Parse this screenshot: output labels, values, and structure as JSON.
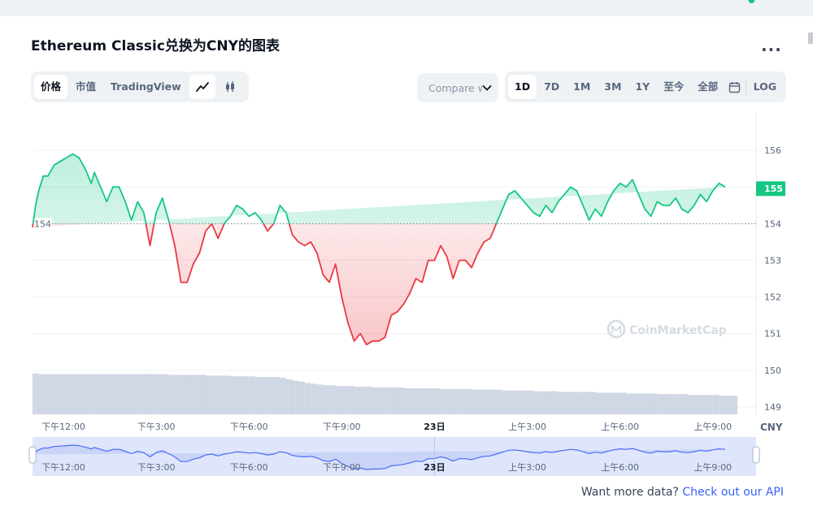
{
  "title": "Ethereum Classic兑换为CNY的图表",
  "more_label": "...",
  "metric_tabs": [
    {
      "label": "价格",
      "active": true
    },
    {
      "label": "市值",
      "active": false
    },
    {
      "label": "TradingView",
      "active": false
    }
  ],
  "chart_type_buttons": [
    {
      "icon": "line-chart-icon",
      "active": true
    },
    {
      "icon": "candlestick-icon",
      "active": false
    }
  ],
  "compare": {
    "label": "Compare with"
  },
  "time_ranges": [
    {
      "label": "1D",
      "active": true
    },
    {
      "label": "7D",
      "active": false
    },
    {
      "label": "1M",
      "active": false
    },
    {
      "label": "3M",
      "active": false
    },
    {
      "label": "1Y",
      "active": false
    },
    {
      "label": "至今",
      "active": false
    },
    {
      "label": "全部",
      "active": false
    },
    {
      "label": "calendar-icon",
      "active": false
    },
    {
      "label": "LOG",
      "active": false
    }
  ],
  "watermark": "CoinMarketCap",
  "currency_label": "CNY",
  "footer": {
    "text": "Want more data?",
    "link": "Check out our API"
  },
  "colors": {
    "up": "#16c784",
    "down": "#ea3943",
    "accent": "#3861fb",
    "volume": "#cfd6e4"
  },
  "chart_data": {
    "type": "line",
    "baseline": 154,
    "baseline_label": "154",
    "current_price": 155,
    "current_label": "155",
    "ylim": [
      148.8,
      157
    ],
    "y_ticks": [
      156,
      155,
      154,
      153,
      152,
      151,
      150,
      149
    ],
    "x_ticks": [
      "下午12:00",
      "下午3:00",
      "下午6:00",
      "下午9:00",
      "23日",
      "上午3:00",
      "上午6:00",
      "上午9:00"
    ],
    "x_tick_hours": [
      1,
      4,
      7,
      10,
      13,
      16,
      19,
      22
    ],
    "x_range_hours": [
      0,
      23.4
    ],
    "series": [
      {
        "hours": [
          0,
          0.1,
          0.2,
          0.35,
          0.5,
          0.7,
          0.9,
          1.1,
          1.3,
          1.5,
          1.7,
          1.9,
          2.0,
          2.2,
          2.4,
          2.6,
          2.8,
          3.0,
          3.2,
          3.4,
          3.6,
          3.8,
          4.0,
          4.2,
          4.4,
          4.6,
          4.8,
          5.0,
          5.2,
          5.4,
          5.6,
          5.8,
          6.0,
          6.2,
          6.4,
          6.6,
          6.8,
          7.0,
          7.2,
          7.4,
          7.6,
          7.8,
          8.0,
          8.2,
          8.4,
          8.6,
          8.8,
          9.0,
          9.2,
          9.4,
          9.6,
          9.8,
          10.0,
          10.2,
          10.4,
          10.6,
          10.8,
          11.0,
          11.2,
          11.4,
          11.6,
          11.8,
          12.0,
          12.2,
          12.4,
          12.6,
          12.8,
          13.0,
          13.2,
          13.4,
          13.6,
          13.8,
          14.0,
          14.2,
          14.4,
          14.6,
          14.8,
          15.0,
          15.2,
          15.4,
          15.6,
          15.8,
          16.0,
          16.2,
          16.4,
          16.6,
          16.8,
          17.0,
          17.2,
          17.4,
          17.6,
          17.8,
          18.0,
          18.2,
          18.4,
          18.6,
          18.8,
          19.0,
          19.2,
          19.4,
          19.6,
          19.8,
          20.0,
          20.2,
          20.4,
          20.6,
          20.8,
          21.0,
          21.2,
          21.4,
          21.6,
          21.8,
          22.0,
          22.2,
          22.4,
          22.6,
          22.8,
          23.0,
          23.2
        ],
        "values": [
          153.9,
          154.5,
          154.9,
          155.3,
          155.3,
          155.6,
          155.7,
          155.8,
          155.9,
          155.8,
          155.5,
          155.1,
          155.4,
          155.0,
          154.6,
          155.0,
          155.0,
          154.6,
          154.1,
          154.6,
          154.3,
          153.4,
          154.3,
          154.7,
          154.1,
          153.4,
          152.4,
          152.4,
          152.9,
          153.2,
          153.8,
          154.0,
          153.6,
          154.0,
          154.2,
          154.5,
          154.4,
          154.2,
          154.3,
          154.1,
          153.8,
          154.0,
          154.5,
          154.3,
          153.7,
          153.5,
          153.4,
          153.5,
          153.2,
          152.6,
          152.4,
          152.9,
          152.0,
          151.3,
          150.8,
          151.0,
          150.7,
          150.8,
          150.8,
          150.9,
          151.5,
          151.6,
          151.8,
          152.1,
          152.5,
          152.4,
          153.0,
          153.0,
          153.4,
          153.1,
          152.5,
          153.0,
          153.0,
          152.8,
          153.2,
          153.5,
          153.6,
          154.0,
          154.4,
          154.8,
          154.9,
          154.7,
          154.5,
          154.3,
          154.2,
          154.5,
          154.3,
          154.6,
          154.8,
          155.0,
          154.9,
          154.5,
          154.1,
          154.4,
          154.2,
          154.6,
          154.9,
          155.1,
          155.0,
          155.2,
          154.8,
          154.4,
          154.2,
          154.6,
          154.5,
          154.5,
          154.7,
          154.4,
          154.3,
          154.5,
          154.8,
          154.6,
          154.9,
          155.1,
          155.0
        ],
        "volume": [
          0.55,
          0.55,
          0.54,
          0.54,
          0.54,
          0.54,
          0.54,
          0.54,
          0.54,
          0.54,
          0.54,
          0.54,
          0.54,
          0.54,
          0.54,
          0.54,
          0.54,
          0.54,
          0.54,
          0.54,
          0.54,
          0.54,
          0.54,
          0.54,
          0.53,
          0.53,
          0.53,
          0.53,
          0.53,
          0.53,
          0.52,
          0.52,
          0.52,
          0.52,
          0.51,
          0.51,
          0.51,
          0.51,
          0.5,
          0.5,
          0.5,
          0.5,
          0.49,
          0.47,
          0.45,
          0.44,
          0.42,
          0.41,
          0.4,
          0.39,
          0.39,
          0.38,
          0.38,
          0.38,
          0.37,
          0.37,
          0.37,
          0.36,
          0.36,
          0.36,
          0.36,
          0.36,
          0.35,
          0.35,
          0.35,
          0.35,
          0.35,
          0.35,
          0.34,
          0.34,
          0.34,
          0.34,
          0.34,
          0.33,
          0.33,
          0.33,
          0.33,
          0.33,
          0.32,
          0.32,
          0.32,
          0.32,
          0.32,
          0.31,
          0.31,
          0.31,
          0.31,
          0.3,
          0.3,
          0.3,
          0.3,
          0.3,
          0.3,
          0.29,
          0.29,
          0.29,
          0.29,
          0.29,
          0.28,
          0.28,
          0.28,
          0.28,
          0.28,
          0.27,
          0.27,
          0.27,
          0.27,
          0.27,
          0.26,
          0.26,
          0.26,
          0.26,
          0.26,
          0.25,
          0.25,
          0.25
        ]
      }
    ],
    "navigator_x_ticks": [
      "下午12:00",
      "下午3:00",
      "下午6:00",
      "下午9:00",
      "23日",
      "上午3:00",
      "上午6:00",
      "上午9:00"
    ]
  }
}
